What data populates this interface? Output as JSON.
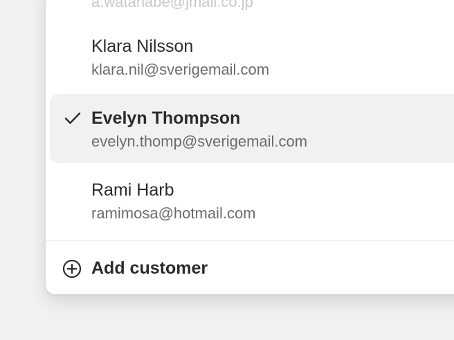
{
  "customer_list": {
    "items": [
      {
        "name": "",
        "email": "a.watanabe@jmail.co.jp",
        "selected": false
      },
      {
        "name": "Klara Nilsson",
        "email": "klara.nil@sverigemail.com",
        "selected": false
      },
      {
        "name": "Evelyn Thompson",
        "email": "evelyn.thomp@sverigemail.com",
        "selected": true
      },
      {
        "name": "Rami Harb",
        "email": "ramimosa@hotmail.com",
        "selected": false
      }
    ],
    "selected_icon": "check-icon"
  },
  "footer": {
    "add_label": "Add customer",
    "add_icon": "plus-circle-icon"
  },
  "colors": {
    "selected_background": "#f1f1f1",
    "text_primary": "#2b2b2b",
    "text_secondary": "#6b6b6b"
  }
}
